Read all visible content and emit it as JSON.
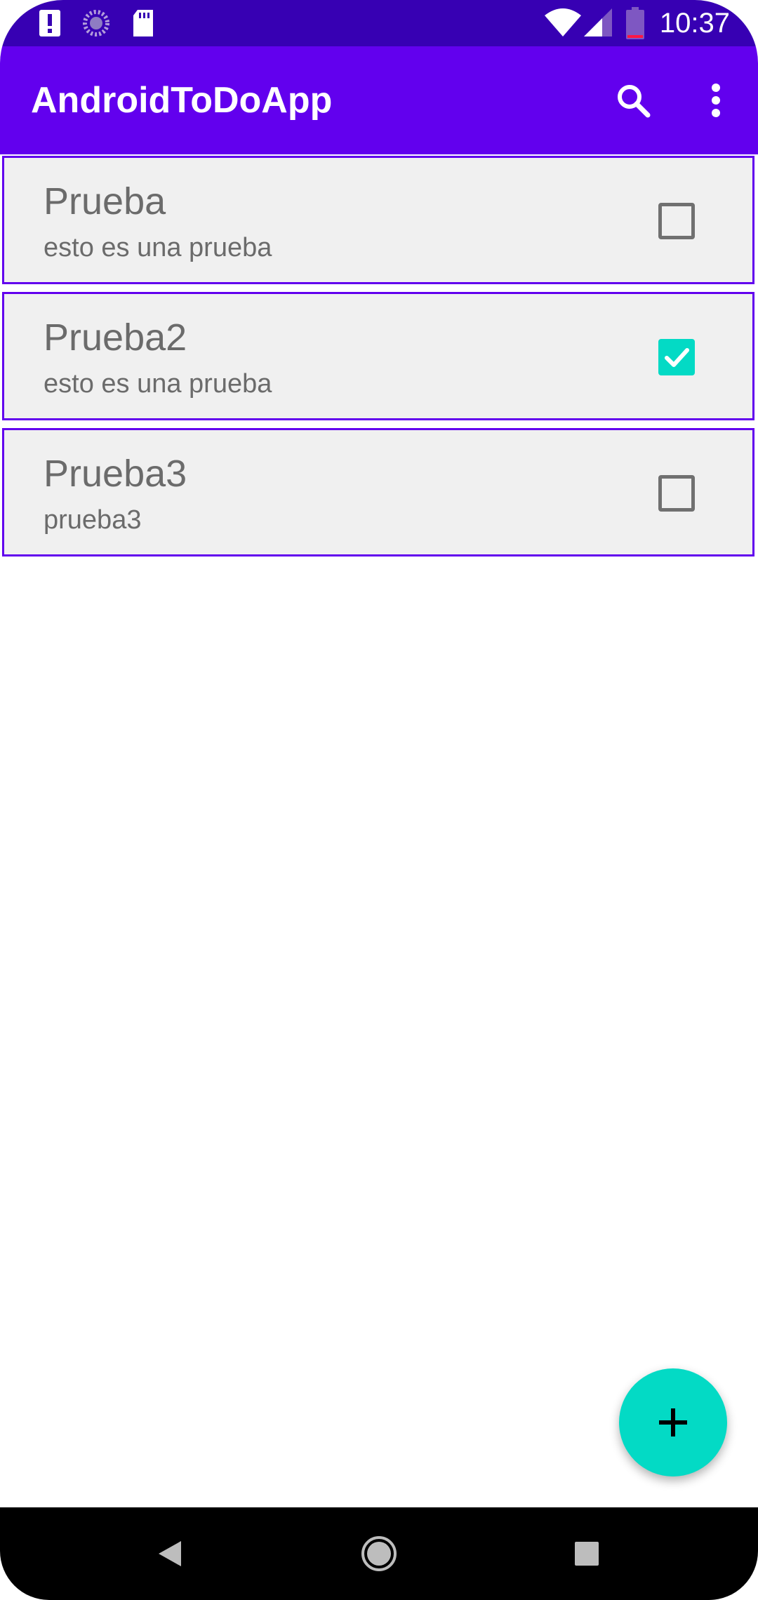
{
  "status_bar": {
    "time": "10:37",
    "icons": [
      "alert-icon",
      "sync-icon",
      "sd-card-icon",
      "wifi-icon",
      "signal-icon",
      "battery-icon"
    ]
  },
  "app_bar": {
    "title": "AndroidToDoApp",
    "actions": [
      "search-icon",
      "more-vert-icon"
    ]
  },
  "todos": [
    {
      "title": "Prueba",
      "description": "esto es una prueba",
      "checked": false
    },
    {
      "title": "Prueba2",
      "description": "esto es una prueba",
      "checked": true
    },
    {
      "title": "Prueba3",
      "description": "prueba3",
      "checked": false
    }
  ],
  "fab": {
    "icon": "add-icon"
  },
  "nav_bar": {
    "icons": [
      "back-icon",
      "home-icon",
      "recents-icon"
    ]
  },
  "colors": {
    "status_bar": "#3700b3",
    "primary": "#6200ee",
    "accent": "#03dac5",
    "card_background": "#f0f0f0",
    "text_secondary": "#6b6b6b"
  }
}
